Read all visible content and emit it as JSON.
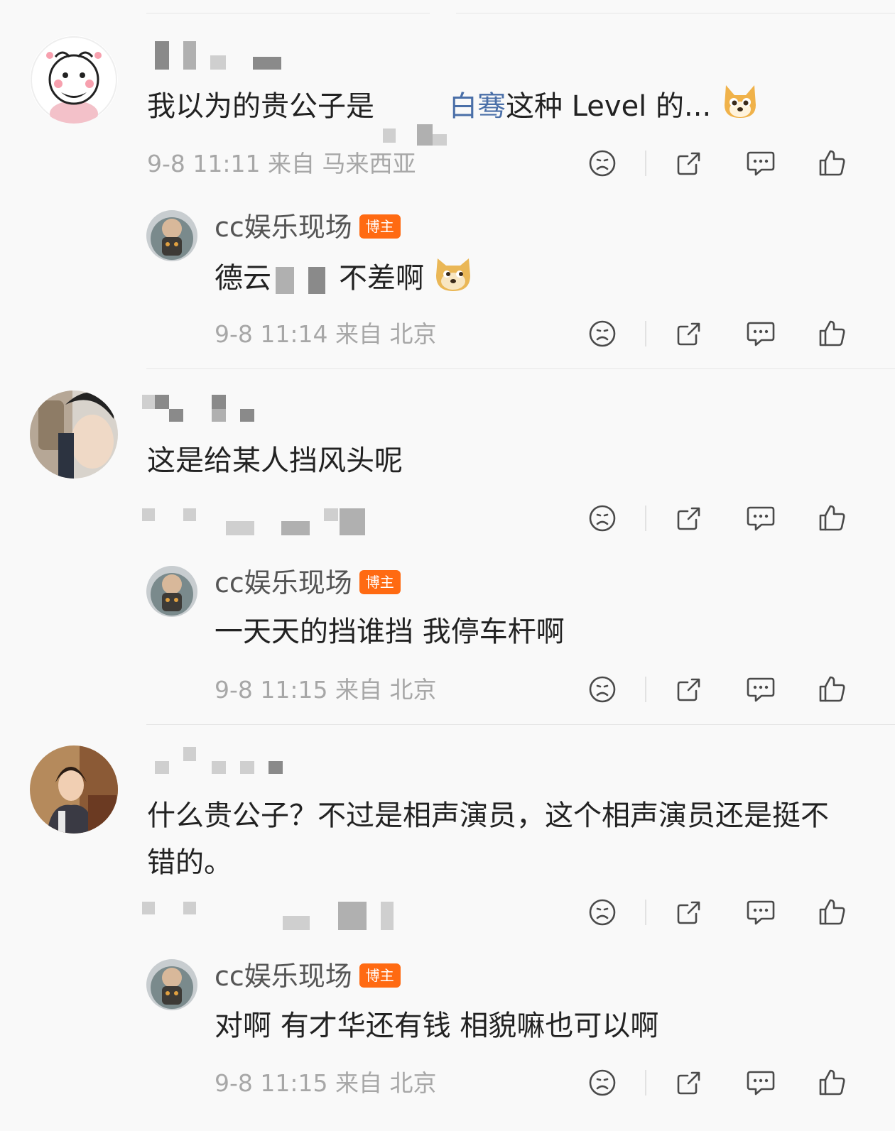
{
  "comments": [
    {
      "text_part1": "我以为的贵公子是",
      "text_link": "白骞",
      "text_part2": "这种 Level 的...",
      "meta": "9-8 11:11  来自 马来西亚",
      "reply": {
        "name": "cc娱乐现场",
        "badge": "博主",
        "text_part1": "德云",
        "text_part2": "不差啊",
        "meta": "9-8 11:14  来自 北京"
      }
    },
    {
      "text": "这是给某人挡风头呢",
      "reply": {
        "name": "cc娱乐现场",
        "badge": "博主",
        "text": "一天天的挡谁挡 我停车杆啊",
        "meta": "9-8 11:15  来自 北京"
      }
    },
    {
      "text": "什么贵公子？不过是相声演员，这个相声演员还是挺不错的。",
      "reply": {
        "name": "cc娱乐现场",
        "badge": "博主",
        "text": "对啊 有才华还有钱 相貌嘛也可以啊",
        "meta": "9-8 11:15  来自 北京"
      }
    }
  ],
  "icons": [
    "dislike-icon",
    "share-icon",
    "comment-icon",
    "like-icon"
  ],
  "colors": {
    "badge": "#ff6a12",
    "link": "#4a6fa8",
    "meta": "#a7a7a7"
  }
}
